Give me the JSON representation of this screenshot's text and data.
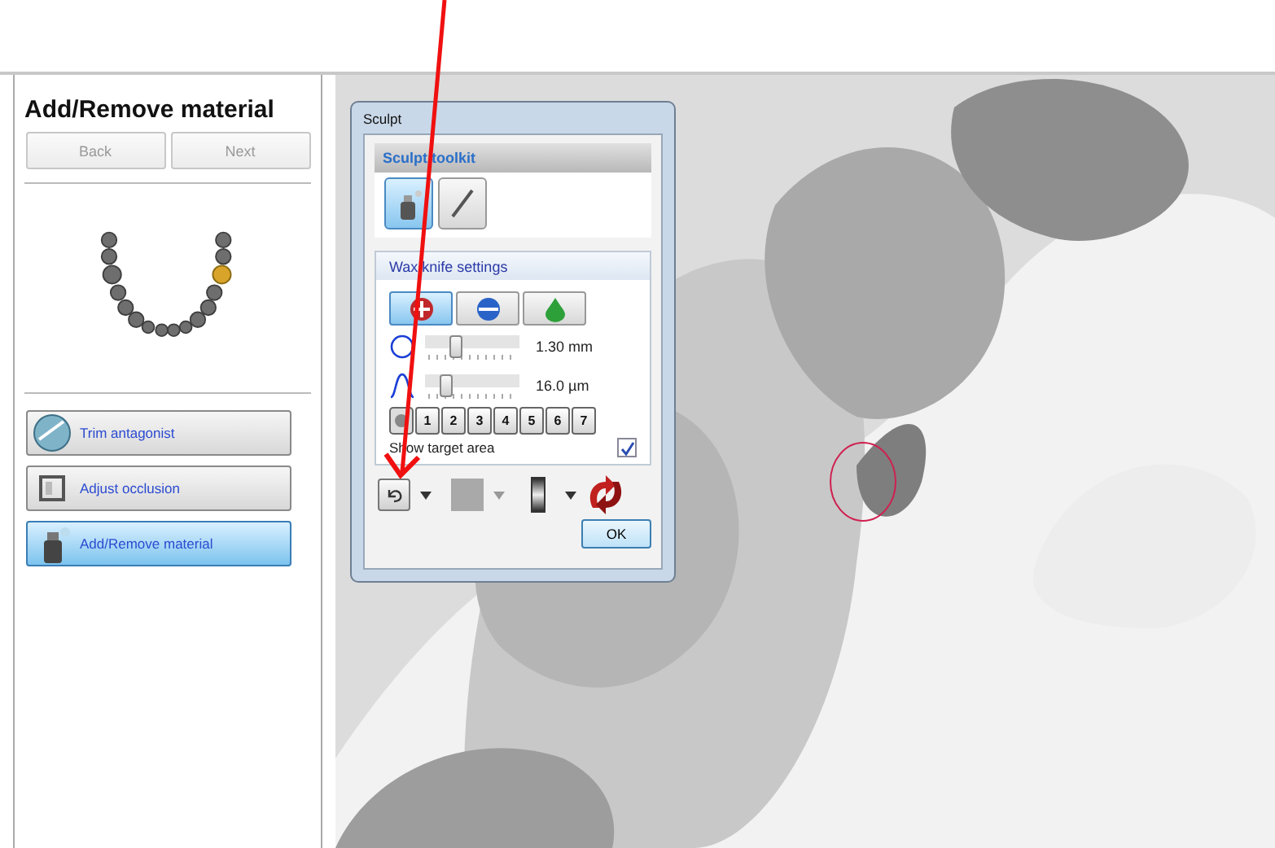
{
  "panel": {
    "title": "Add/Remove material",
    "nav_buttons": [
      {
        "label": "Back",
        "disabled": true
      },
      {
        "label": "Next",
        "disabled": true
      }
    ],
    "steps": [
      {
        "kind": "trim",
        "label": "Trim antagonist",
        "selected": false
      },
      {
        "kind": "occlusion",
        "label": "Adjust occlusion",
        "selected": false
      },
      {
        "kind": "material",
        "label": "Add/Remove material",
        "selected": true
      }
    ]
  },
  "dialog": {
    "title": "Sculpt",
    "toolkit": {
      "title": "Sculpt toolkit",
      "tools": [
        {
          "kind": "spray",
          "selected": true
        },
        {
          "kind": "knife",
          "selected": false
        }
      ]
    },
    "settings": {
      "title": "Wax knife settings",
      "modes": [
        {
          "kind": "add",
          "selected": true
        },
        {
          "kind": "remove",
          "selected": false
        },
        {
          "kind": "smooth",
          "selected": false
        }
      ],
      "sliders": [
        {
          "kind": "radius",
          "level": 0.33,
          "reading": "1.30 mm"
        },
        {
          "kind": "height",
          "level": 0.22,
          "reading": "16.0 µm"
        }
      ],
      "presets": [
        "1",
        "2",
        "3",
        "4",
        "5",
        "6",
        "7"
      ],
      "show_target_area": {
        "label": "Show target area",
        "checked": true
      }
    },
    "ok": "OK"
  }
}
